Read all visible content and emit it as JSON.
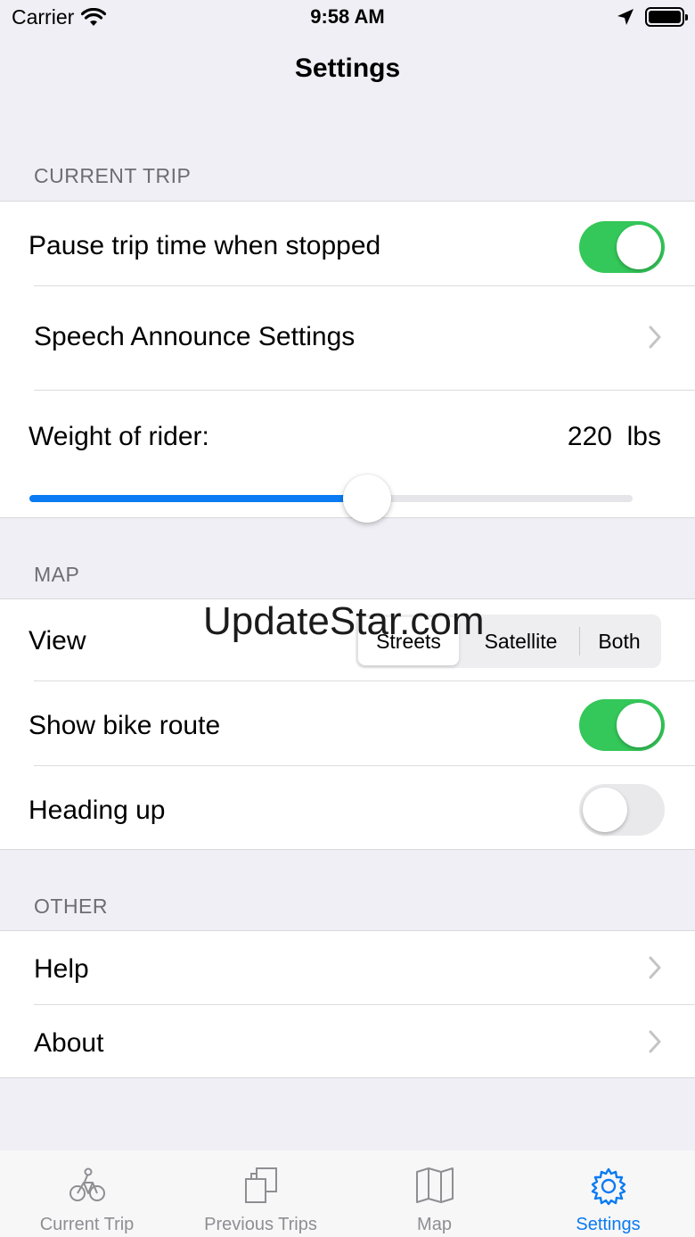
{
  "status_bar": {
    "carrier": "Carrier",
    "time": "9:58 AM"
  },
  "nav": {
    "title": "Settings"
  },
  "sections": {
    "current_trip": {
      "header": "CURRENT TRIP",
      "pause_label": "Pause trip time when stopped",
      "pause_on": true,
      "speech_label": "Speech Announce Settings",
      "weight_label": "Weight of rider:",
      "weight_value": "220",
      "weight_unit": "lbs",
      "weight_slider_fraction": 0.56
    },
    "map": {
      "header": "MAP",
      "view_label": "View",
      "view_options": [
        "Streets",
        "Satellite",
        "Both"
      ],
      "view_selected": "Streets",
      "bike_route_label": "Show bike route",
      "bike_route_on": true,
      "heading_label": "Heading up",
      "heading_on": false
    },
    "other": {
      "header": "OTHER",
      "help_label": "Help",
      "about_label": "About"
    }
  },
  "watermark": "UpdateStar.com",
  "tabs": [
    {
      "label": "Current Trip",
      "icon": "bicycle-icon"
    },
    {
      "label": "Previous Trips",
      "icon": "stacked-pages-icon"
    },
    {
      "label": "Map",
      "icon": "map-icon"
    },
    {
      "label": "Settings",
      "icon": "gear-icon",
      "active": true
    }
  ],
  "colors": {
    "accent": "#0a7bf2",
    "toggle_on": "#34c759",
    "background": "#f0eff5"
  }
}
